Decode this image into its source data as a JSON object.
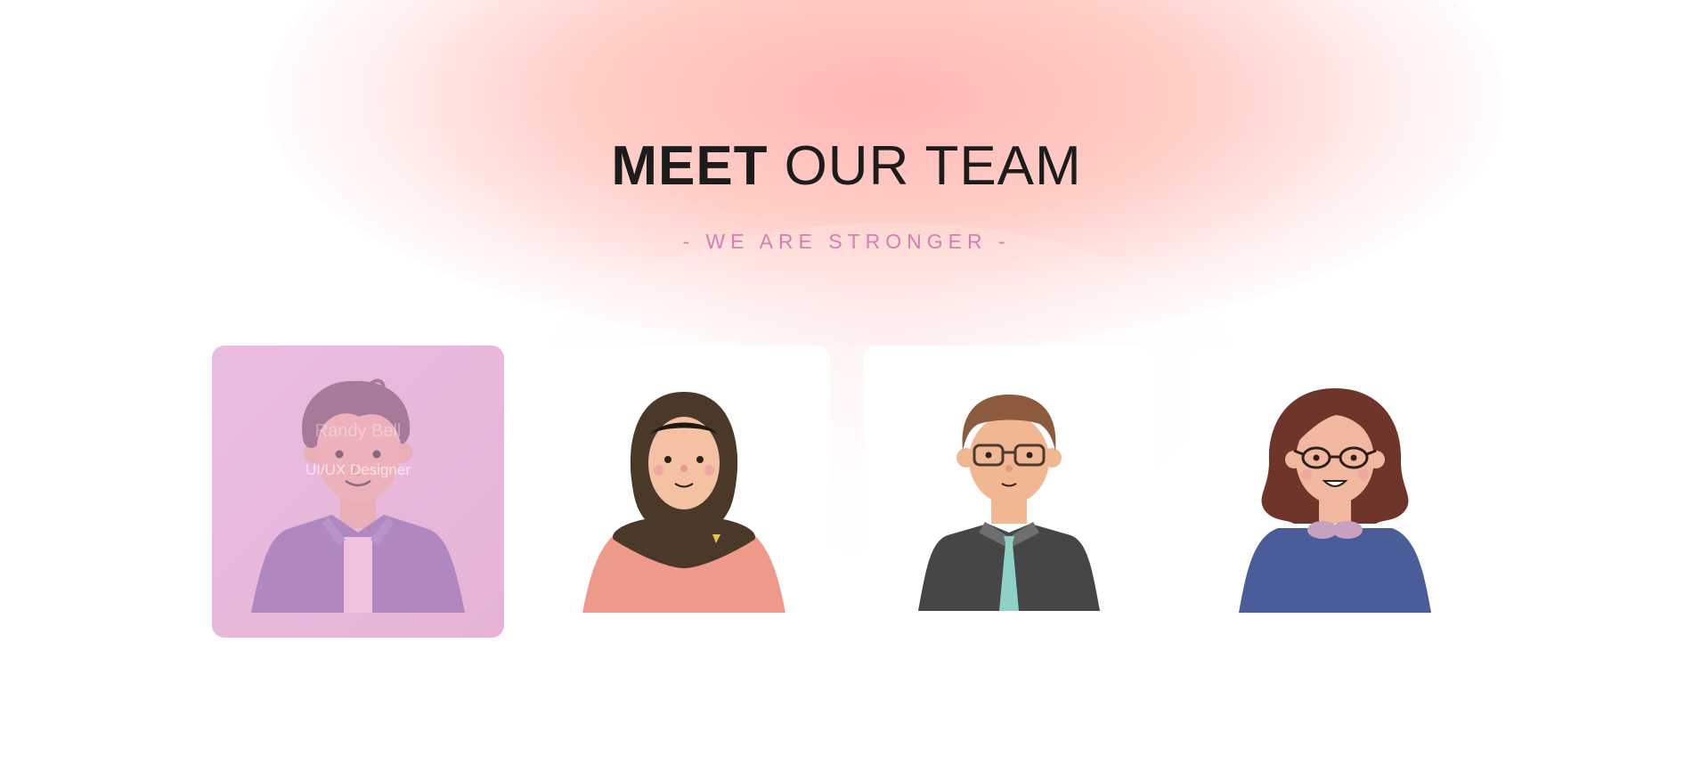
{
  "header": {
    "title_bold": "MEET",
    "title_light": "OUR TEAM",
    "subtitle": "- WE ARE STRONGER -"
  },
  "members": [
    {
      "name": "Randy Bell",
      "role": "UI/UX Designer",
      "avatar": "young-man-avatar",
      "hovered": true
    },
    {
      "avatar": "hijab-woman-avatar",
      "hovered": false
    },
    {
      "avatar": "man-with-glasses-avatar",
      "hovered": false
    },
    {
      "avatar": "woman-with-glasses-avatar",
      "hovered": false
    }
  ],
  "colors": {
    "title": "#1c1c1c",
    "subtitle": "#d47fb4",
    "glow": "#ffb9b2",
    "hover_overlay": "#e4aad4"
  }
}
